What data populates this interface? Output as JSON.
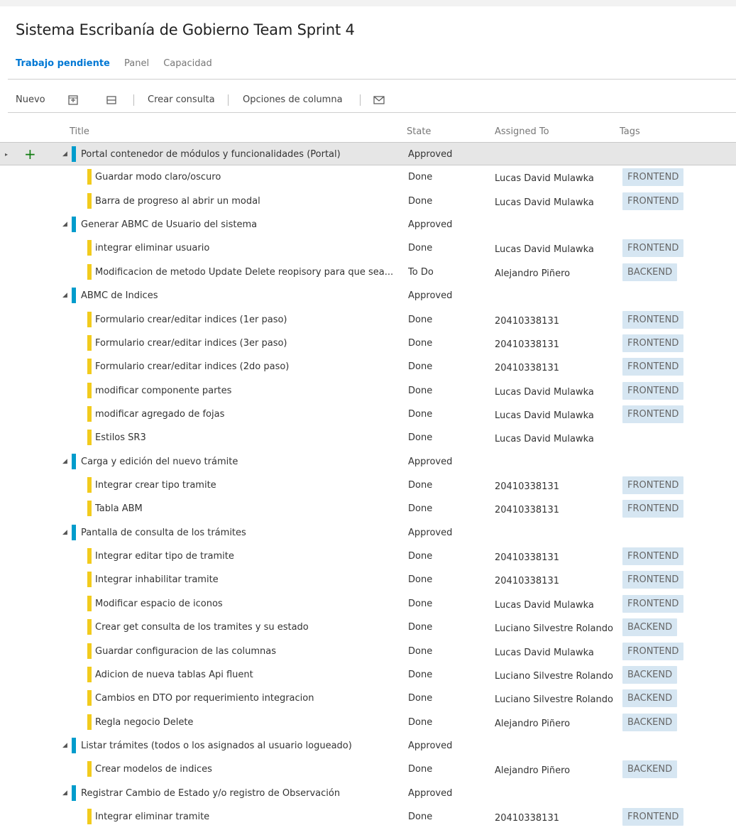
{
  "page": {
    "title": "Sistema Escribanía de Gobierno Team Sprint 4"
  },
  "tabs": [
    {
      "label": "Trabajo pendiente",
      "active": true
    },
    {
      "label": "Panel",
      "active": false
    },
    {
      "label": "Capacidad",
      "active": false
    }
  ],
  "toolbar": {
    "new_label": "Nuevo",
    "expand_icon": "expand-all-icon",
    "collapse_icon": "collapse-all-icon",
    "create_query_label": "Crear consulta",
    "column_options_label": "Opciones de columna",
    "email_icon": "mail-icon"
  },
  "columns": {
    "title": "Title",
    "state": "State",
    "assigned": "Assigned To",
    "tags": "Tags"
  },
  "colors": {
    "accent": "#0078d4",
    "parent_bar": "#009ccc",
    "child_bar": "#f2cb1d",
    "tag_bg": "#d6e6f2",
    "add_icon": "#107c10"
  },
  "rows": [
    {
      "level": 0,
      "title": "Portal contenedor de módulos y funcionalidades (Portal)",
      "state": "Approved",
      "assigned": "",
      "tag": "",
      "selected": true
    },
    {
      "level": 1,
      "title": "Guardar modo claro/oscuro",
      "state": "Done",
      "assigned": "Lucas David Mulawka",
      "tag": "FRONTEND"
    },
    {
      "level": 1,
      "title": "Barra de progreso al abrir un modal",
      "state": "Done",
      "assigned": "Lucas David Mulawka",
      "tag": "FRONTEND"
    },
    {
      "level": 0,
      "title": "Generar ABMC de Usuario del sistema",
      "state": "Approved",
      "assigned": "",
      "tag": ""
    },
    {
      "level": 1,
      "title": " integrar eliminar usuario",
      "state": "Done",
      "assigned": "Lucas David Mulawka",
      "tag": "FRONTEND"
    },
    {
      "level": 1,
      "title": " Modificacion de metodo Update Delete reopisory para que sea...",
      "state": "To Do",
      "assigned": "Alejandro Piñero",
      "tag": "BACKEND"
    },
    {
      "level": 0,
      "title": "ABMC de Indices",
      "state": "Approved",
      "assigned": "",
      "tag": ""
    },
    {
      "level": 1,
      "title": "Formulario crear/editar indices (1er paso)",
      "state": "Done",
      "assigned": "20410338131",
      "tag": "FRONTEND"
    },
    {
      "level": 1,
      "title": "Formulario crear/editar indices (3er paso)",
      "state": "Done",
      "assigned": "20410338131",
      "tag": "FRONTEND"
    },
    {
      "level": 1,
      "title": "Formulario crear/editar indices (2do paso)",
      "state": "Done",
      "assigned": "20410338131",
      "tag": "FRONTEND"
    },
    {
      "level": 1,
      "title": "modificar componente partes",
      "state": "Done",
      "assigned": "Lucas David Mulawka",
      "tag": "FRONTEND"
    },
    {
      "level": 1,
      "title": "modificar agregado de fojas",
      "state": "Done",
      "assigned": "Lucas David Mulawka",
      "tag": "FRONTEND"
    },
    {
      "level": 1,
      "title": "Estilos SR3",
      "state": "Done",
      "assigned": "Lucas David Mulawka",
      "tag": ""
    },
    {
      "level": 0,
      "title": "Carga y edición del nuevo trámite",
      "state": "Approved",
      "assigned": "",
      "tag": ""
    },
    {
      "level": 1,
      "title": " Integrar crear tipo tramite",
      "state": "Done",
      "assigned": "20410338131",
      "tag": "FRONTEND"
    },
    {
      "level": 1,
      "title": "Tabla ABM",
      "state": "Done",
      "assigned": "20410338131",
      "tag": "FRONTEND"
    },
    {
      "level": 0,
      "title": "Pantalla de consulta de los trámites",
      "state": "Approved",
      "assigned": "",
      "tag": ""
    },
    {
      "level": 1,
      "title": "Integrar editar tipo de tramite",
      "state": "Done",
      "assigned": "20410338131",
      "tag": "FRONTEND"
    },
    {
      "level": 1,
      "title": "Integrar inhabilitar tramite",
      "state": "Done",
      "assigned": "20410338131",
      "tag": "FRONTEND"
    },
    {
      "level": 1,
      "title": " Modificar espacio de iconos",
      "state": "Done",
      "assigned": "Lucas David Mulawka",
      "tag": "FRONTEND"
    },
    {
      "level": 1,
      "title": "Crear get consulta de los tramites y su estado",
      "state": "Done",
      "assigned": "Luciano Silvestre Rolando",
      "tag": "BACKEND"
    },
    {
      "level": 1,
      "title": "Guardar configuracion de las columnas",
      "state": "Done",
      "assigned": "Lucas David Mulawka",
      "tag": "FRONTEND"
    },
    {
      "level": 1,
      "title": "Adicion de nueva tablas Api fluent",
      "state": "Done",
      "assigned": "Luciano Silvestre Rolando",
      "tag": "BACKEND"
    },
    {
      "level": 1,
      "title": "Cambios en DTO por requerimiento integracion",
      "state": "Done",
      "assigned": "Luciano Silvestre Rolando",
      "tag": "BACKEND"
    },
    {
      "level": 1,
      "title": "Regla negocio Delete",
      "state": "Done",
      "assigned": "Alejandro Piñero",
      "tag": "BACKEND"
    },
    {
      "level": 0,
      "title": "Listar trámites (todos o los asignados al usuario logueado)",
      "state": "Approved",
      "assigned": "",
      "tag": ""
    },
    {
      "level": 1,
      "title": "Crear modelos de indices",
      "state": "Done",
      "assigned": "Alejandro Piñero",
      "tag": "BACKEND"
    },
    {
      "level": 0,
      "title": "Registrar Cambio de Estado y/o registro de Observación",
      "state": "Approved",
      "assigned": "",
      "tag": ""
    },
    {
      "level": 1,
      "title": " Integrar eliminar tramite",
      "state": "Done",
      "assigned": "20410338131",
      "tag": "FRONTEND"
    }
  ]
}
